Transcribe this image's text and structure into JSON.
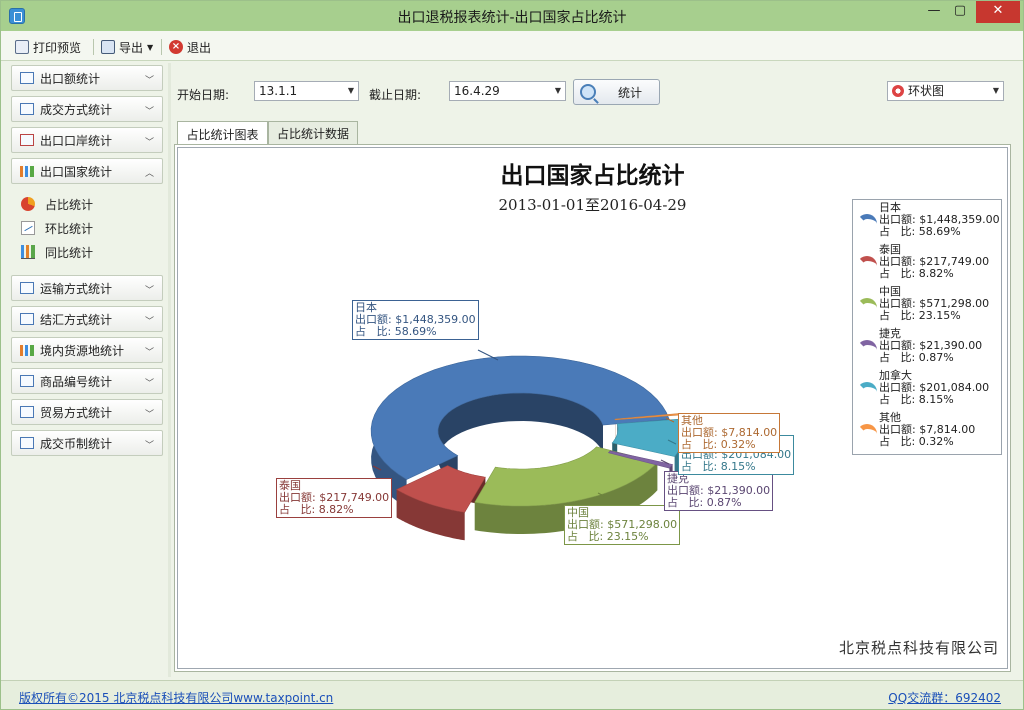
{
  "window": {
    "title": "出口退税报表统计-出口国家占比统计",
    "min_glyph": "—",
    "max_glyph": "▢",
    "close_glyph": "✕"
  },
  "toolbar": {
    "print_preview": "打印预览",
    "export": "导出",
    "exit": "退出"
  },
  "sidebar": {
    "groups": [
      {
        "label": "出口额统计",
        "icon": "bar-chart-icon"
      },
      {
        "label": "成交方式统计",
        "icon": "scatter-chart-icon"
      },
      {
        "label": "出口口岸统计",
        "icon": "map-icon"
      },
      {
        "label": "出口国家统计",
        "icon": "column-chart-icon",
        "expanded": true
      },
      {
        "label": "运输方式统计",
        "icon": "list-icon"
      },
      {
        "label": "结汇方式统计",
        "icon": "window-chart-icon"
      },
      {
        "label": "境内货源地统计",
        "icon": "column-chart-icon"
      },
      {
        "label": "商品编号统计",
        "icon": "scatter-chart-icon"
      },
      {
        "label": "贸易方式统计",
        "icon": "window-chart-icon"
      },
      {
        "label": "成交币制统计",
        "icon": "currency-chart-icon"
      }
    ],
    "sub_items": [
      {
        "label": "占比统计",
        "icon": "pie-icon"
      },
      {
        "label": "环比统计",
        "icon": "line-chart-icon"
      },
      {
        "label": "同比统计",
        "icon": "bar-chart-icon"
      }
    ]
  },
  "filters": {
    "start_label": "开始日期:",
    "start_value": "13.1.1",
    "end_label": "截止日期:",
    "end_value": "16.4.29",
    "stat_button": "统计",
    "chart_type": "环状图"
  },
  "tabs": [
    {
      "label": "占比统计图表",
      "active": true
    },
    {
      "label": "占比统计数据",
      "active": false
    }
  ],
  "chart_data": {
    "type": "doughnut",
    "title": "出口国家占比统计",
    "subtitle": "2013-01-01至2016-04-29",
    "series": [
      {
        "name": "日本",
        "amount": "$1,448,359.00",
        "share": "58.69%",
        "value": 58.69,
        "color": "#4a7ab8"
      },
      {
        "name": "泰国",
        "amount": "$217,749.00",
        "share": "8.82%",
        "value": 8.82,
        "color": "#c0504d"
      },
      {
        "name": "中国",
        "amount": "$571,298.00",
        "share": "23.15%",
        "value": 23.15,
        "color": "#9bbb59"
      },
      {
        "name": "捷克",
        "amount": "$21,390.00",
        "share": "0.87%",
        "value": 0.87,
        "color": "#8064a2"
      },
      {
        "name": "加拿大",
        "amount": "$201,084.00",
        "share": "8.15%",
        "value": 8.15,
        "color": "#4bacc6"
      },
      {
        "name": "其他",
        "amount": "$7,814.00",
        "share": "0.32%",
        "value": 0.32,
        "color": "#f79646"
      }
    ],
    "amount_label": "出口额: ",
    "share_label": "占   比: ",
    "legend_position": "right"
  },
  "watermark": "北京税点科技有限公司",
  "statusbar": {
    "copyright": "版权所有©2015 北京税点科技有限公司www.taxpoint.cn",
    "qq": "QQ交流群：692402"
  }
}
